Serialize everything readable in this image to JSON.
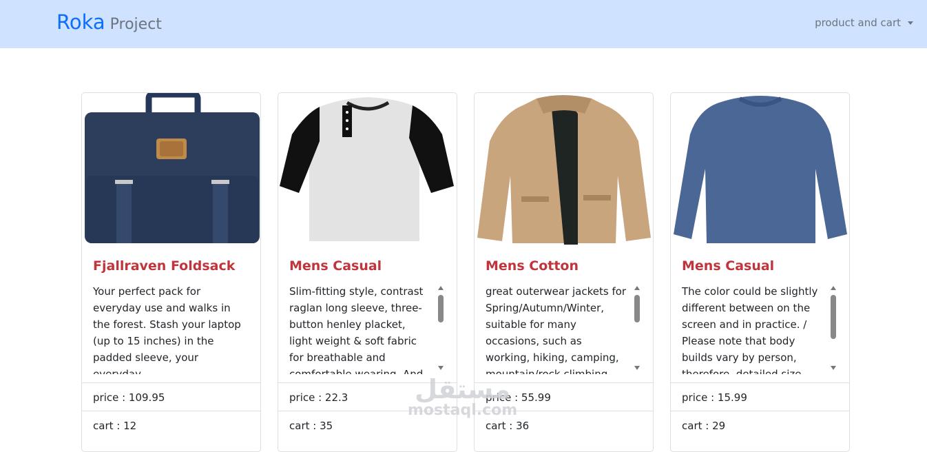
{
  "navbar": {
    "brand_main": "Roka",
    "brand_sub": "Project",
    "dropdown_label": "product and cart",
    "bg_color": "#cfe2ff"
  },
  "products": [
    {
      "title": "Fjallraven Foldsack",
      "description": "Your perfect pack for everyday use and walks in the forest. Stash your laptop (up to 15 inches) in the padded sleeve, your everyday",
      "price": "price : 109.95",
      "cart": "cart : 12",
      "image_icon": "backpack-image"
    },
    {
      "title": "Mens Casual",
      "description": "Slim-fitting style, contrast raglan long sleeve, three-button henley placket, light weight & soft fabric for breathable and comfortable wearing. And Solid stitched",
      "price": "price : 22.3",
      "cart": "cart : 35",
      "image_icon": "raglan-shirt-image"
    },
    {
      "title": "Mens Cotton",
      "description": "great outerwear jackets for Spring/Autumn/Winter, suitable for many occasions, such as working, hiking, camping, mountain/rock climbing, cycling, traveling",
      "price": "price : 55.99",
      "cart": "cart : 36",
      "image_icon": "cotton-jacket-image"
    },
    {
      "title": "Mens Casual",
      "description": "The color could be slightly different between on the screen and in practice. / Please note that body builds vary by person, therefore, detailed size information",
      "price": "price : 15.99",
      "cart": "cart : 29",
      "image_icon": "long-sleeve-shirt-image"
    }
  ],
  "watermark": {
    "arabic": "مستقل",
    "latin": "mostaql.com"
  },
  "colors": {
    "brand_blue": "#0d6efd",
    "title_red": "#c0343c",
    "muted": "#6c757d"
  }
}
